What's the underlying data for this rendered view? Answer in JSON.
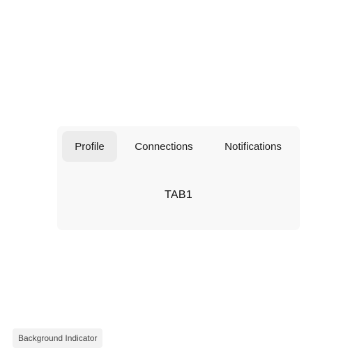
{
  "tabs": {
    "items": [
      {
        "label": "Profile",
        "active": true
      },
      {
        "label": "Connections",
        "active": false
      },
      {
        "label": "Notifications",
        "active": false
      }
    ],
    "panel_text": "TAB1"
  },
  "indicator": {
    "label": "Background Indicator"
  },
  "colors": {
    "card_background": "#f8f8f8",
    "active_tab_background": "#ececec",
    "indicator_background": "#f2f2f2"
  }
}
